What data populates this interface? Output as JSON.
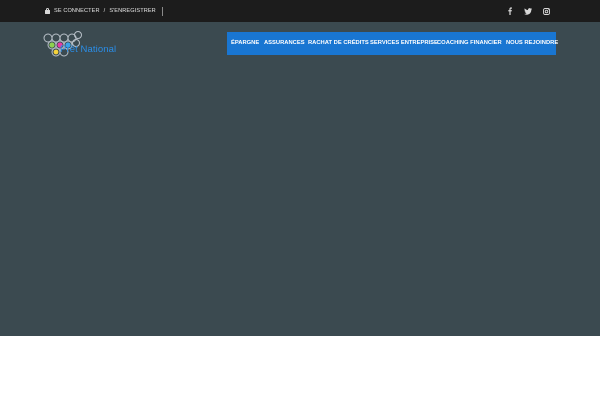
{
  "topbar": {
    "login_label": "SE CONNECTER",
    "separator": "/",
    "register_label": "S'ENREGISTRER",
    "social": [
      {
        "icon": "facebook-icon"
      },
      {
        "icon": "twitter-icon"
      },
      {
        "icon": "instagram-icon"
      }
    ]
  },
  "brand": {
    "name": "Prêt National"
  },
  "nav": {
    "items": [
      {
        "label": "ÉPARGNE"
      },
      {
        "label": "ASSURANCES"
      },
      {
        "label": "RACHAT DE CRÉDITS"
      },
      {
        "label": "SERVICES ENTREPRISE"
      },
      {
        "label": "COACHING FINANCIER"
      },
      {
        "label": "NOUS REJOINDRE"
      }
    ]
  },
  "colors": {
    "topbar_bg": "#1c1c1c",
    "hero_bg": "#3b4a50",
    "nav_bg": "#1976d2",
    "brand_blue": "#2a8ee8"
  }
}
